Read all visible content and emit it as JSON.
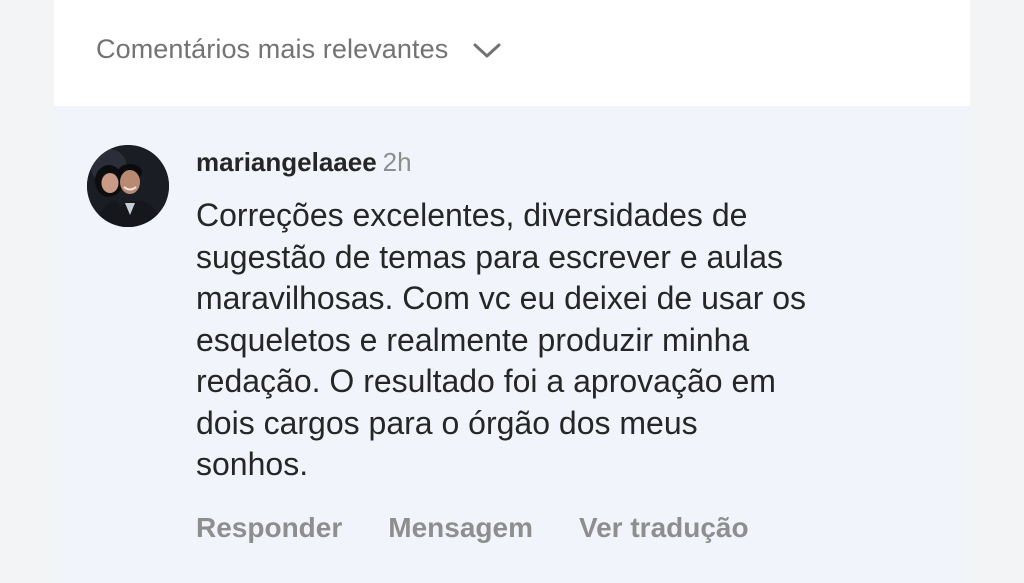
{
  "header": {
    "sort_label": "Comentários mais relevantes",
    "sort_icon": "chevron-down-icon"
  },
  "comment": {
    "avatar": "user-avatar-photo",
    "username": "mariangelaaee",
    "timestamp": "2h",
    "text": "Correções excelentes, diversidades de\nsugestão de temas para escrever e aulas\nmaravilhosas. Com vc eu deixei de usar os\nesqueletos e realmente produzir minha\nredação. O resultado foi a aprovação em\ndois cargos para o órgão dos meus\nsonhos.",
    "actions": {
      "reply": "Responder",
      "message": "Mensagem",
      "translate": "Ver tradução"
    }
  },
  "colors": {
    "header_bg": "#ffffff",
    "comment_bg": "#f1f5fb",
    "primary_text": "#262626",
    "secondary_text": "#8e8e8e"
  }
}
